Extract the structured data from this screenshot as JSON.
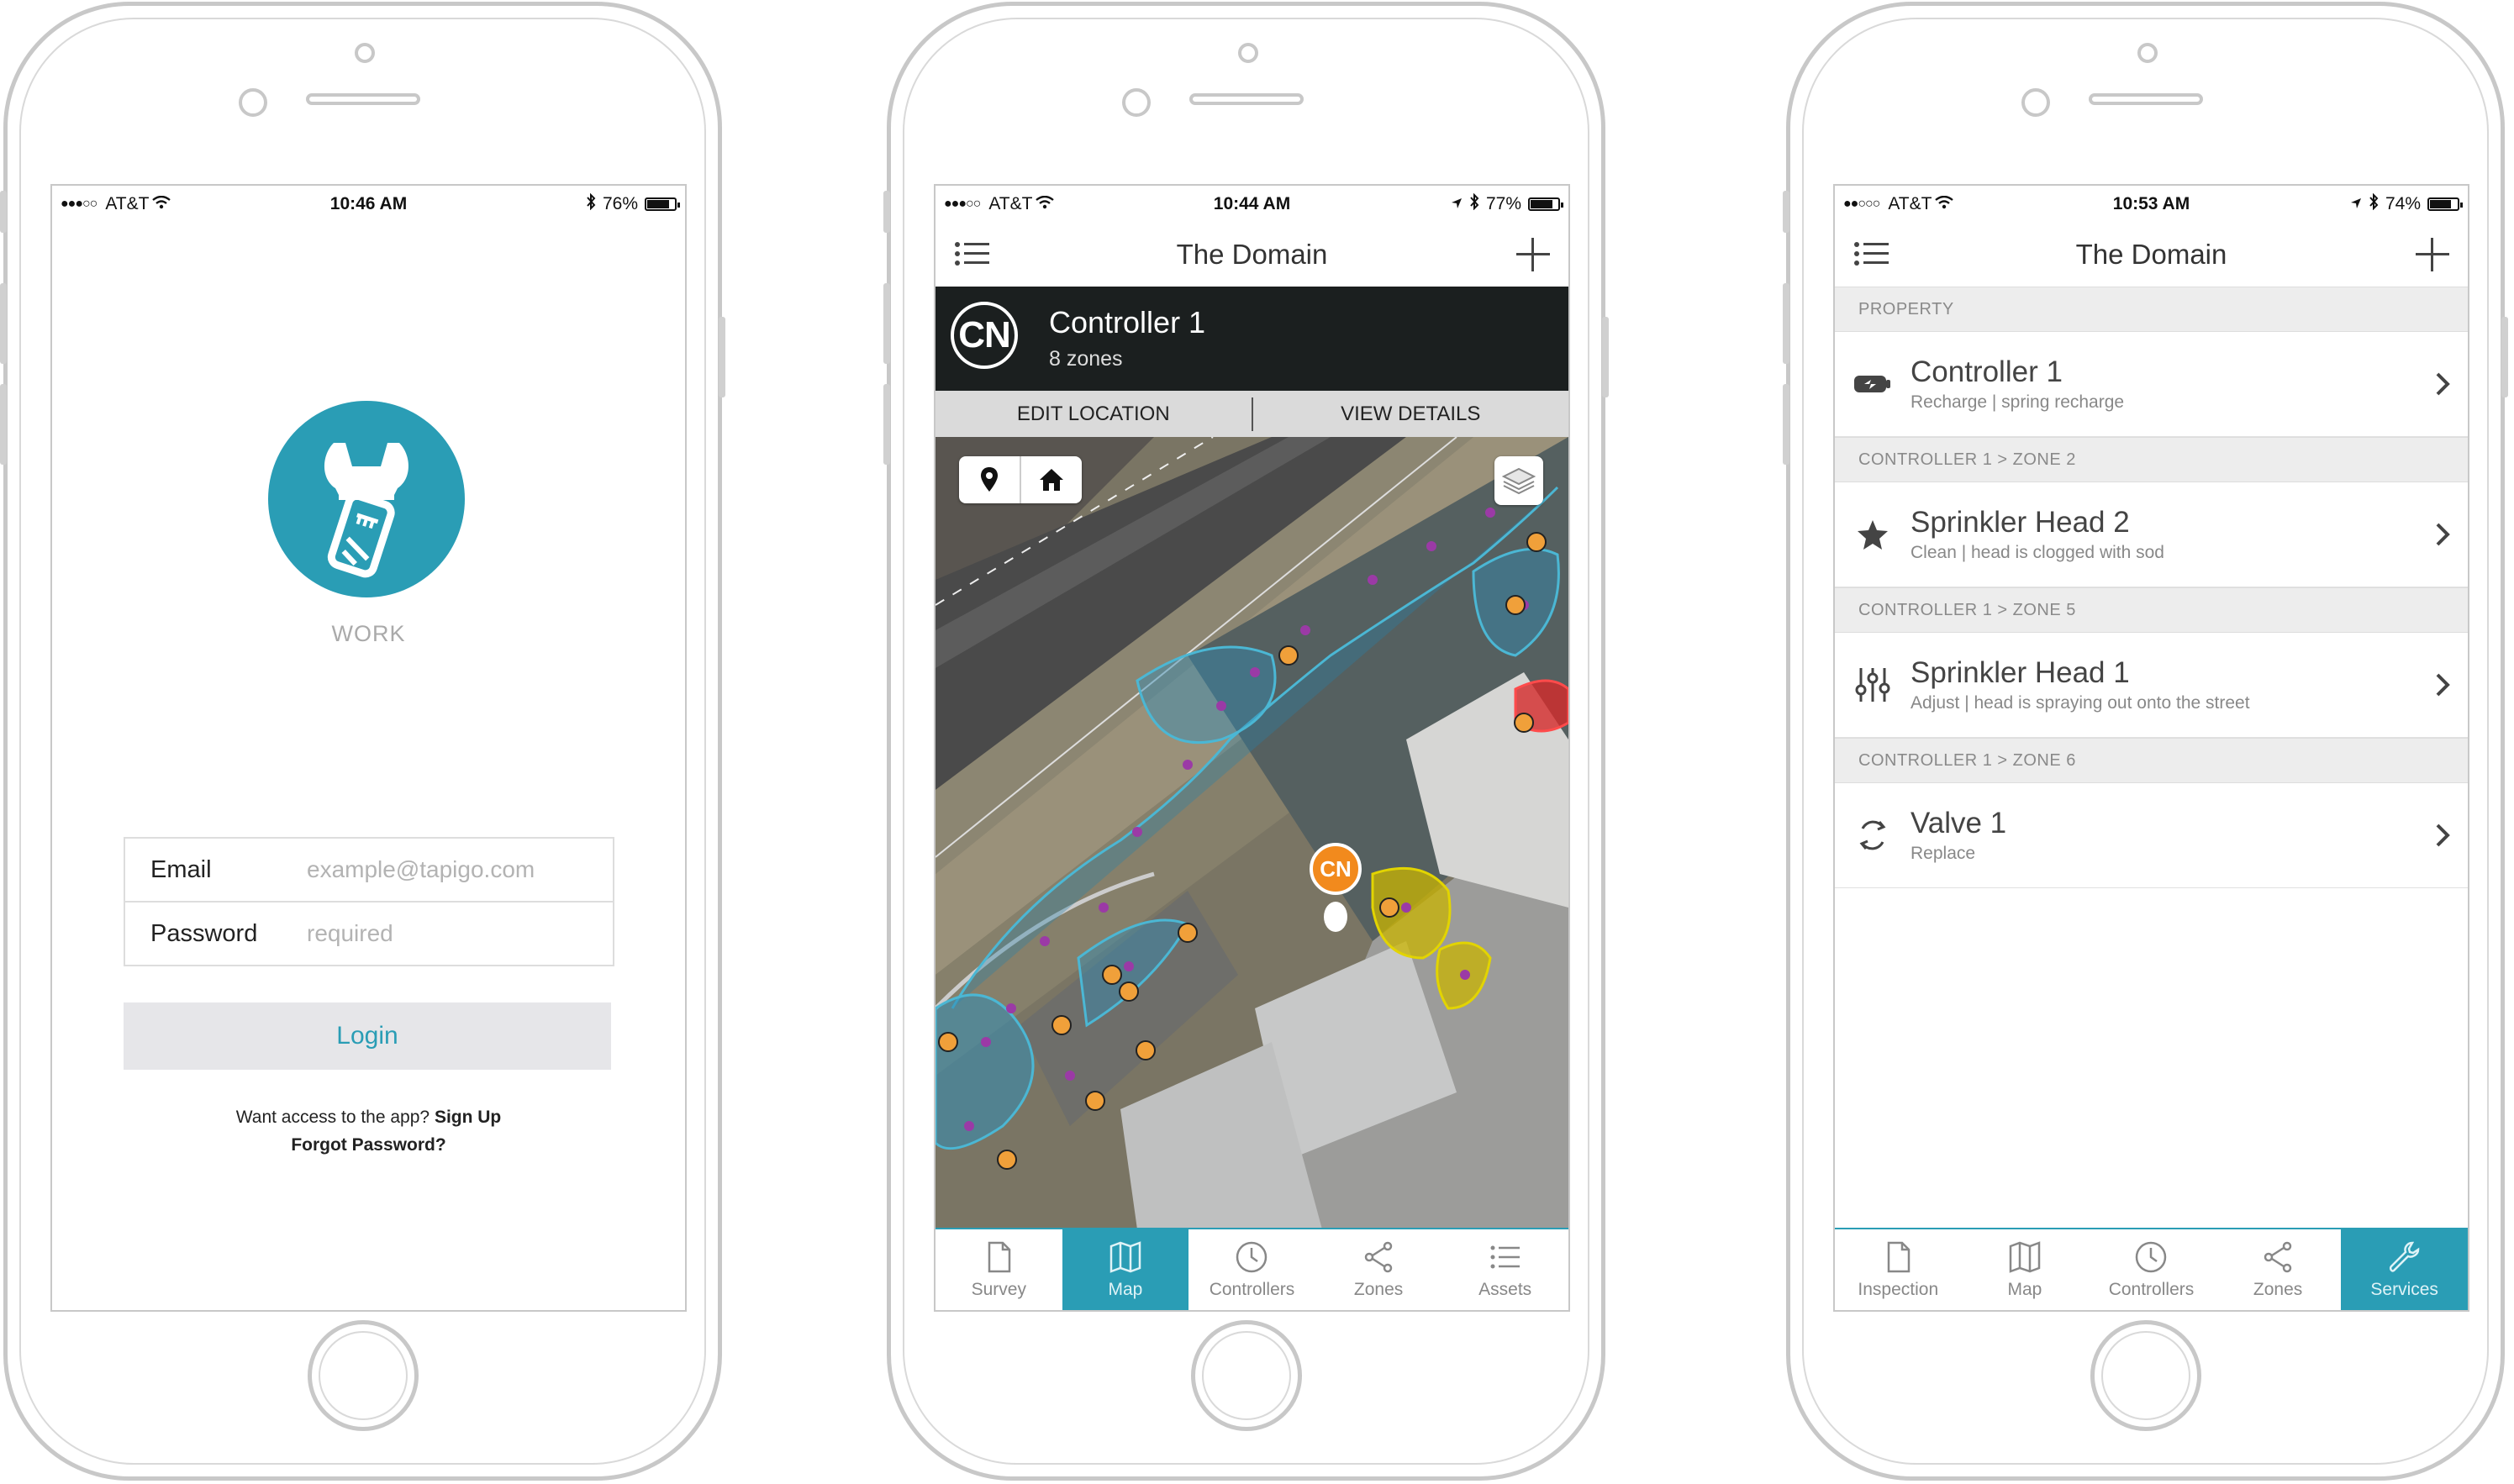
{
  "phones": [
    {
      "status": {
        "carrier": "AT&T",
        "time": "10:46 AM",
        "battery": "76%",
        "battery_level": 0.76
      },
      "login": {
        "app_name": "WORK",
        "email_label": "Email",
        "email_placeholder": "example@tapigo.com",
        "password_label": "Password",
        "password_placeholder": "required",
        "login_button": "Login",
        "access_text": "Want access to the app?",
        "signup_link": "Sign Up",
        "forgot_link": "Forgot Password?"
      }
    },
    {
      "status": {
        "carrier": "AT&T",
        "time": "10:44 AM",
        "battery": "77%",
        "battery_level": 0.77
      },
      "nav": {
        "title": "The Domain"
      },
      "controller": {
        "badge": "CN",
        "name": "Controller 1",
        "zones": "8 zones"
      },
      "actions": {
        "edit": "EDIT LOCATION",
        "view": "VIEW DETAILS"
      },
      "map": {
        "pin_label": "CN"
      },
      "tabs": [
        {
          "label": "Survey",
          "icon": "document-icon"
        },
        {
          "label": "Map",
          "icon": "map-icon",
          "active": true
        },
        {
          "label": "Controllers",
          "icon": "clock-icon"
        },
        {
          "label": "Zones",
          "icon": "share-icon"
        },
        {
          "label": "Assets",
          "icon": "list-icon"
        }
      ]
    },
    {
      "status": {
        "carrier": "AT&T",
        "time": "10:53 AM",
        "battery": "74%",
        "battery_level": 0.74
      },
      "nav": {
        "title": "The Domain"
      },
      "sections": [
        {
          "header": "PROPERTY",
          "title": "Controller 1",
          "detail": "Recharge | spring recharge",
          "icon": "battery-charge-icon"
        },
        {
          "header": "CONTROLLER 1 > ZONE 2",
          "title": "Sprinkler Head 2",
          "detail": "Clean | head is clogged with sod",
          "icon": "star-icon"
        },
        {
          "header": "CONTROLLER 1 > ZONE 5",
          "title": "Sprinkler Head 1",
          "detail": "Adjust | head is spraying out onto the street",
          "icon": "sliders-icon"
        },
        {
          "header": "CONTROLLER 1 > ZONE 6",
          "title": "Valve 1",
          "detail": "Replace",
          "icon": "refresh-icon"
        }
      ],
      "tabs": [
        {
          "label": "Inspection",
          "icon": "document-icon"
        },
        {
          "label": "Map",
          "icon": "map-icon"
        },
        {
          "label": "Controllers",
          "icon": "clock-icon"
        },
        {
          "label": "Zones",
          "icon": "share-icon"
        },
        {
          "label": "Services",
          "icon": "wrench-icon",
          "active": true
        }
      ]
    }
  ],
  "colors": {
    "accent": "#2a9db5",
    "pin": "#f28a1d",
    "zone_yellow": "#c9b400",
    "zone_red": "#d42a2a"
  }
}
